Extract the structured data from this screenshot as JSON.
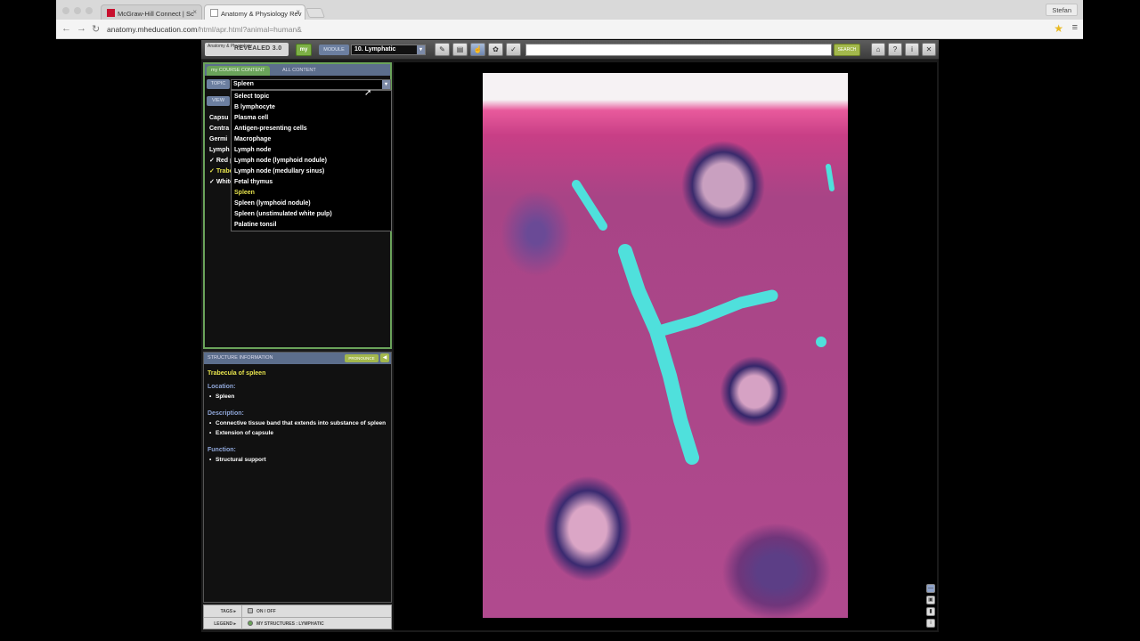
{
  "browser": {
    "tabs": [
      {
        "title": "McGraw-Hill Connect | Sc",
        "close": "×"
      },
      {
        "title": "Anatomy & Physiology Rev",
        "close": "×"
      }
    ],
    "url_host": "anatomy.mheducation.com",
    "url_path": "/html/apr.html?animal=human&",
    "profile": "Stefan"
  },
  "app": {
    "logo_small": "Anatomy & Physiology",
    "logo_big": "REVEALED 3.0",
    "my_label": "my",
    "module_label": "MODULE",
    "module_value": "10. Lymphatic",
    "search_label": "SEARCH",
    "content_tabs": [
      "my COURSE CONTENT",
      "ALL CONTENT"
    ],
    "topic_label": "TOPIC",
    "view_label": "VIEW",
    "topic_value": "Spleen",
    "topic_options": [
      "Select topic",
      "B lymphocyte",
      "Plasma cell",
      "Antigen-presenting cells",
      "Macrophage",
      "Lymph node",
      "Lymph node (lymphoid nodule)",
      "Lymph node (medullary sinus)",
      "Fetal thymus",
      "Spleen",
      "Spleen (lymphoid nodule)",
      "Spleen (unstimulated white pulp)",
      "Palatine tonsil"
    ],
    "selected_option_index": 9,
    "structures": [
      {
        "label": "Capsu",
        "check": ""
      },
      {
        "label": "Centra",
        "check": ""
      },
      {
        "label": "Germi",
        "check": ""
      },
      {
        "label": "Lymph",
        "check": ""
      },
      {
        "label": "Red pu",
        "check": "✓"
      },
      {
        "label": "Trabec",
        "check": "✓"
      },
      {
        "label": "White",
        "check": "✓"
      }
    ],
    "info": {
      "header": "STRUCTURE INFORMATION",
      "pronounce": "PRONOUNCE",
      "title": "Trabecula of spleen",
      "location_label": "Location:",
      "location": [
        "Spleen"
      ],
      "description_label": "Description:",
      "description": [
        "Connective tissue band that extends into substance of spleen",
        "Extension of capsule"
      ],
      "function_label": "Function:",
      "function": [
        "Structural support"
      ]
    },
    "footer": {
      "tags_label": "TAGS",
      "tags_value": "ON / OFF",
      "legend_label": "LEGEND",
      "legend_value": "MY STRUCTURES : LYMPHATIC"
    }
  },
  "colors": {
    "accent_green": "#6aa35a",
    "highlight_yellow": "#e8e44d",
    "trabecula_cyan": "#4fe0dc"
  }
}
